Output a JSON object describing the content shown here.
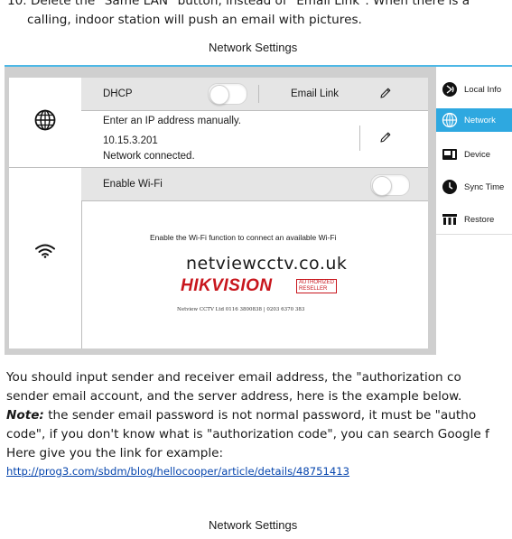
{
  "doc": {
    "top_line_1": "10. Delete the \"Same LAN\" button, instead of \"Email Link\". When there is a",
    "top_line_2": "calling, indoor station will push an email with pictures.",
    "caption_1": "Network Settings",
    "para_line_1": "You should input sender and receiver email address, the \"authorization co",
    "para_line_2": "sender email account, and the server address, here is the example below.",
    "note_label": "Note:",
    "note_line_1": " the sender email password is not normal password, it must be \"autho",
    "note_line_2": "code\", if you don't know what is \"authorization code\", you can search Google f",
    "note_line_3": "Here give you the link for example:",
    "link": "http://prog3.com/sbdm/blog/hellocooper/article/details/48751413",
    "caption_2": "Network Settings"
  },
  "screen": {
    "dhcp_label": "DHCP",
    "dhcp_toggle_on": false,
    "email_link_label": "Email Link",
    "ip_prompt": "Enter an IP address manually.",
    "ip_address": "10.15.3.201",
    "network_status": "Network connected.",
    "wifi_label": "Enable Wi-Fi",
    "wifi_toggle_on": false,
    "wifi_hint": "Enable the Wi-Fi function to connect an available Wi-Fi",
    "icons": {
      "network": "globe-icon",
      "wifi": "wifi-icon",
      "edit": "pencil-icon"
    },
    "accent_color": "#2ea8e0",
    "sidebar": [
      {
        "label": "Local Info",
        "icon": "vibrate-icon",
        "active": false
      },
      {
        "label": "Network",
        "icon": "globe-icon",
        "active": true
      },
      {
        "label": "Device",
        "icon": "device-icon",
        "active": false
      },
      {
        "label": "Sync Time",
        "icon": "clock-icon",
        "active": false
      },
      {
        "label": "Restore",
        "icon": "restore-icon",
        "active": false
      }
    ]
  },
  "watermark": {
    "domain": "netviewcctv.co.uk",
    "brand": "HIKVISION",
    "reseller_line_1": "AUTHORIZED",
    "reseller_line_2": "RESELLER",
    "footer": "Netview CCTV Ltd 0116 3800838 | 0203 6370 383",
    "brand_color": "#c8161d"
  }
}
